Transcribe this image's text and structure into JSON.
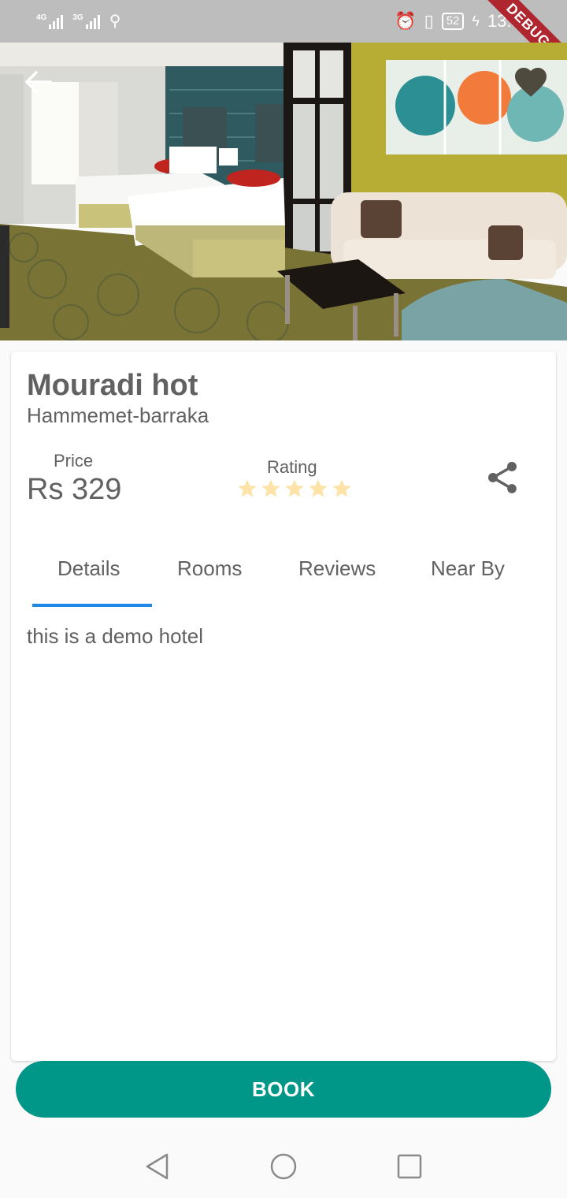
{
  "status_bar": {
    "network1": "4G",
    "network2": "3G",
    "battery": "52",
    "time": "13:56",
    "debug_label": "DEBUG"
  },
  "hero": {
    "image_alt": "Hotel room photo"
  },
  "hotel": {
    "name": "Mouradi hot",
    "location": "Hammemet-barraka",
    "price_label": "Price",
    "price_value": "Rs 329",
    "rating_label": "Rating",
    "rating": 5,
    "rating_max": 5
  },
  "tabs": [
    {
      "label": "Details",
      "selected": true
    },
    {
      "label": "Rooms",
      "selected": false
    },
    {
      "label": "Reviews",
      "selected": false
    },
    {
      "label": "Near By",
      "selected": false
    }
  ],
  "tab_content": {
    "details_text": "this is a demo hotel"
  },
  "actions": {
    "book_label": "BOOK"
  },
  "colors": {
    "accent": "#009688",
    "tab_indicator": "#1e88e5",
    "star": "#fde3a7",
    "text": "#616161"
  }
}
